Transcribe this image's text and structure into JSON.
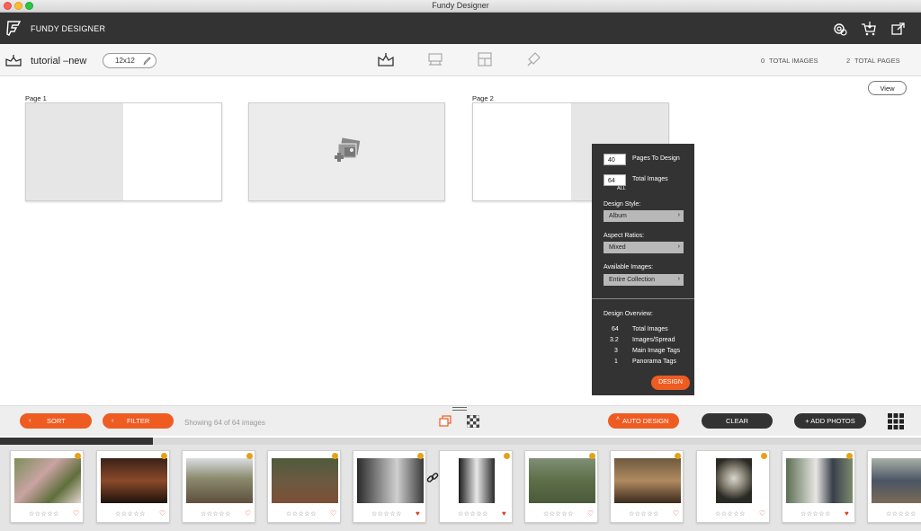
{
  "window": {
    "title": "Fundy Designer"
  },
  "header": {
    "brand": "FUNDY DESIGNER"
  },
  "toolbar": {
    "project_name": "tutorial –new",
    "size": "12x12",
    "total_images_count": "0",
    "total_images_label": "TOTAL IMAGES",
    "total_pages_count": "2",
    "total_pages_label": "TOTAL PAGES"
  },
  "canvas": {
    "page1_label": "Page 1",
    "page2_label": "Page 2",
    "view_label": "View"
  },
  "design_panel": {
    "pages_value": "40",
    "pages_label": "Pages To Design",
    "images_value": "64",
    "images_sublabel": "ALL",
    "images_label": "Total Images",
    "style_label": "Design Style:",
    "style_value": "Album",
    "aspect_label": "Aspect Ratios:",
    "aspect_value": "Mixed",
    "available_label": "Available Images:",
    "available_value": "Entire Collection",
    "overview_title": "Design Overview:",
    "overview": [
      {
        "value": "64",
        "label": "Total Images"
      },
      {
        "value": "3.2",
        "label": "Images/Spread"
      },
      {
        "value": "3",
        "label": "Main Image Tags"
      },
      {
        "value": "1",
        "label": "Panorama Tags"
      }
    ],
    "design_button": "DESIGN"
  },
  "bottom_bar": {
    "sort_label": "SORT",
    "filter_label": "FILTER",
    "showing_text": "Showing 64 of 64 images",
    "auto_design_label": "AUTO DESIGN",
    "clear_label": "CLEAR",
    "add_photos_label": "+ ADD PHOTOS"
  },
  "progress": {
    "fraction": 0.166
  },
  "thumbnails": [
    {
      "subject": "floral arrangement",
      "hearted": false
    },
    {
      "subject": "reception hall",
      "hearted": false
    },
    {
      "subject": "outdoor patio",
      "hearted": false
    },
    {
      "subject": "garden venue",
      "hearted": false
    },
    {
      "subject": "couple portrait",
      "hearted": true
    },
    {
      "subject": "bride black and white",
      "hearted": true
    },
    {
      "subject": "couple in garden",
      "hearted": false
    },
    {
      "subject": "dessert table",
      "hearted": false
    },
    {
      "subject": "balloons",
      "hearted": false
    },
    {
      "subject": "cake cutting",
      "hearted": true
    },
    {
      "subject": "guests",
      "hearted": false
    }
  ],
  "colors": {
    "accent_orange": "#ef5c22",
    "dark": "#333333",
    "sync_badge": "#e3a21a",
    "heart_filled": "#d9401c"
  }
}
